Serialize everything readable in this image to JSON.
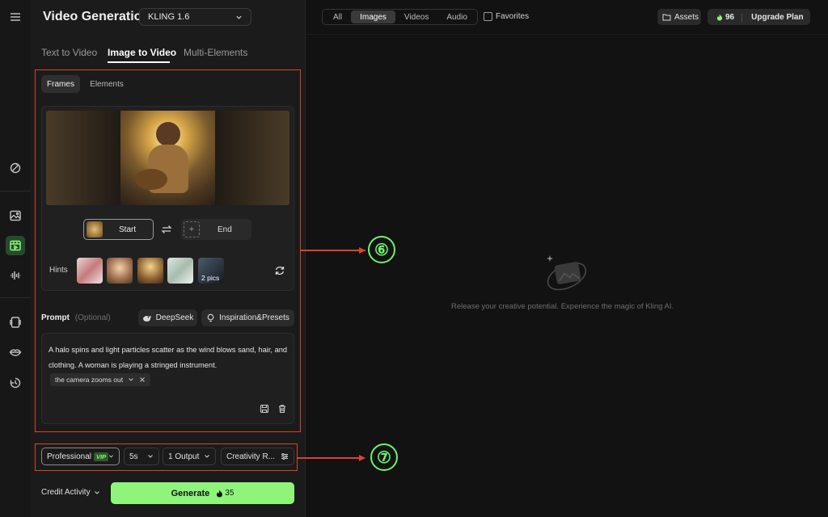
{
  "header": {
    "title": "Video Generation",
    "model": "KLING 1.6",
    "filters": [
      "All",
      "Images",
      "Videos",
      "Audio"
    ],
    "active_filter": "Images",
    "favorites_label": "Favorites",
    "assets_label": "Assets",
    "credits": "96",
    "upgrade_label": "Upgrade Plan"
  },
  "mode_tabs": [
    "Text to Video",
    "Image to Video",
    "Multi-Elements"
  ],
  "active_mode": "Image to Video",
  "sub_tabs": [
    "Frames",
    "Elements"
  ],
  "frames": {
    "start_label": "Start",
    "end_label": "End",
    "end_add": "+"
  },
  "hints": {
    "label": "Hints",
    "more_label": "2 pics"
  },
  "prompt": {
    "label": "Prompt",
    "optional": "(Optional)",
    "deepseek_label": "DeepSeek",
    "inspiration_label": "Inspiration&Presets",
    "text": "A halo spins and light particles scatter as the wind blows sand, hair, and clothing. A woman is playing a stringed instrument.",
    "tag": "the camera zooms out"
  },
  "options": {
    "mode": "Professional",
    "vip_badge": "VIP",
    "duration": "5s",
    "outputs": "1 Output",
    "creativity": "Creativity R..."
  },
  "footer": {
    "credit_activity": "Credit Activity",
    "generate_label": "Generate",
    "generate_cost": "35"
  },
  "annotations": {
    "six": "⑥",
    "seven": "⑦"
  },
  "empty_state": {
    "message": "Release your creative potential. Experience the magic of Kling AI."
  },
  "colors": {
    "accent_green": "#8ef57a",
    "annotation_red": "#d9452b",
    "annotation_green": "#6cf46c"
  }
}
